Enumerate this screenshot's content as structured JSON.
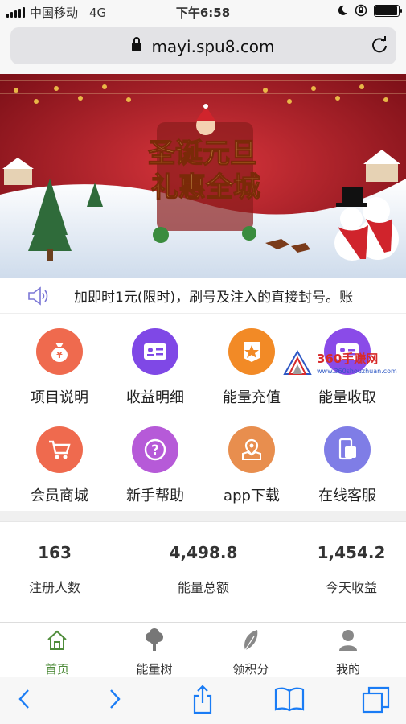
{
  "status_bar": {
    "carrier": "中国移动",
    "network": "4G",
    "time": "下午6:58",
    "battery_level": 0.95
  },
  "browser": {
    "url": "mayi.spu8.com"
  },
  "banner": {
    "title_line1": "圣诞元旦",
    "title_line2": "礼惠全城"
  },
  "notice": {
    "text": "加即时1元(限时)，刷号及注入的直接封号。账"
  },
  "menu": [
    {
      "label": "项目说明",
      "icon": "money-bag-icon",
      "color": "#ef6a4e"
    },
    {
      "label": "收益明细",
      "icon": "id-card-icon",
      "color": "#7f48e6"
    },
    {
      "label": "能量充值",
      "icon": "star-badge-icon",
      "color": "#f28a26"
    },
    {
      "label": "能量收取",
      "icon": "card-icon",
      "color": "#8a4be8"
    },
    {
      "label": "会员商城",
      "icon": "shopping-cart-icon",
      "color": "#ef6a4e"
    },
    {
      "label": "新手帮助",
      "icon": "question-icon",
      "color": "#b65ad8"
    },
    {
      "label": "app下载",
      "icon": "map-pin-icon",
      "color": "#e88e4e"
    },
    {
      "label": "在线客服",
      "icon": "phone-icon",
      "color": "#7f7de6"
    }
  ],
  "watermark": {
    "brand": "360手赚网",
    "site": "www.360shouzhuan.com"
  },
  "stats": [
    {
      "value": "163",
      "label": "注册人数"
    },
    {
      "value": "4,498.8",
      "label": "能量总额"
    },
    {
      "value": "1,454.2",
      "label": "今天收益"
    }
  ],
  "tabs": [
    {
      "label": "首页",
      "icon": "home-icon",
      "active": true
    },
    {
      "label": "能量树",
      "icon": "tree-icon",
      "active": false
    },
    {
      "label": "领积分",
      "icon": "leaf-icon",
      "active": false
    },
    {
      "label": "我的",
      "icon": "user-icon",
      "active": false
    }
  ],
  "colors": {
    "active_tab": "#4f8c3b",
    "banner_red": "#b3232c",
    "link_blue": "#1a7cf5"
  }
}
